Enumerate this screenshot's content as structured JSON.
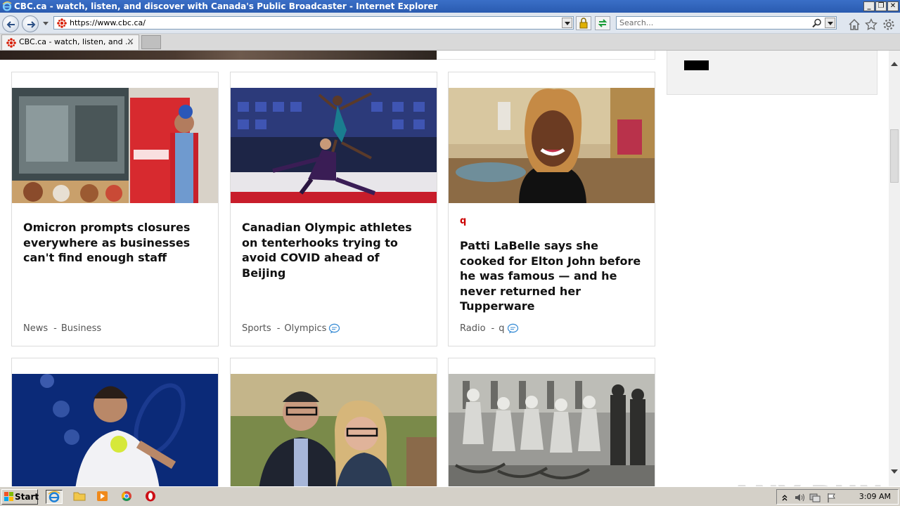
{
  "window": {
    "title": "CBC.ca - watch, listen, and discover with Canada's Public Broadcaster - Internet Explorer"
  },
  "navbar": {
    "url": "https://www.cbc.ca/",
    "search_placeholder": "Search..."
  },
  "tabs": [
    {
      "label": "CBC.ca - watch, listen, and ..."
    }
  ],
  "cards": [
    {
      "kicker": "",
      "headline": "Omicron prompts closures everywhere as businesses can't find enough staff",
      "section": "News",
      "subsection": "Business",
      "has_comments": false
    },
    {
      "kicker": "",
      "headline": "Canadian Olympic athletes on tenterhooks trying to avoid COVID ahead of Beijing",
      "section": "Sports",
      "subsection": "Olympics",
      "has_comments": true
    },
    {
      "kicker": "q",
      "headline": "Patti LaBelle says she cooked for Elton John before he was famous — and he never returned her Tupperware",
      "section": "Radio",
      "subsection": "q",
      "has_comments": true
    }
  ],
  "watermark": "ANY RUN",
  "taskbar": {
    "start_label": "Start",
    "clock": "3:09 AM"
  },
  "colors": {
    "kicker_red": "#cc0000",
    "titlebar_blue": "#2a5bb0",
    "comment_blue": "#3d8fd6"
  }
}
